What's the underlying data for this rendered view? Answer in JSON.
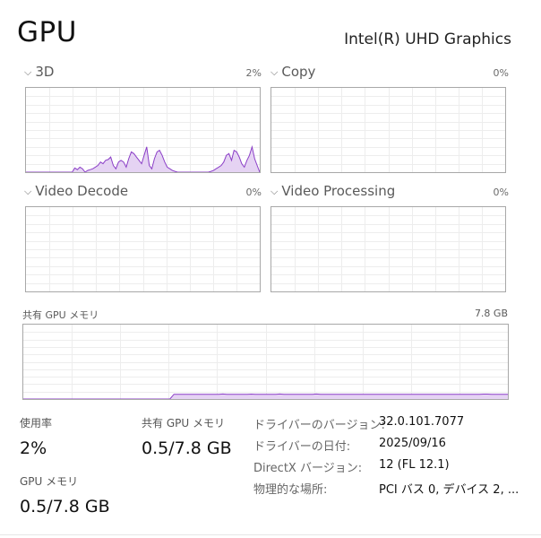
{
  "header": {
    "title": "GPU",
    "device_name": "Intel(R) UHD Graphics"
  },
  "graphs": [
    {
      "label": "3D",
      "percent": "2%",
      "values": [
        0,
        0,
        0,
        0,
        0,
        0,
        0,
        0,
        0,
        0,
        0,
        0,
        0,
        0,
        0,
        0,
        0,
        0,
        0,
        5,
        3,
        6,
        4,
        0,
        2,
        3,
        4,
        6,
        8,
        12,
        10,
        14,
        15,
        18,
        8,
        4,
        12,
        14,
        12,
        6,
        16,
        24,
        22,
        18,
        14,
        10,
        20,
        30,
        8,
        4,
        16,
        24,
        26,
        20,
        12,
        6,
        4,
        2,
        1,
        0,
        0,
        0,
        0,
        0,
        0,
        0,
        0,
        0,
        0,
        0,
        0,
        0,
        1,
        2,
        4,
        6,
        8,
        12,
        20,
        22,
        14,
        26,
        24,
        18,
        10,
        6,
        14,
        20,
        30,
        16,
        8,
        0
      ]
    },
    {
      "label": "Copy",
      "percent": "0%",
      "values": []
    },
    {
      "label": "Video Decode",
      "percent": "0%",
      "values": []
    },
    {
      "label": "Video Processing",
      "percent": "0%",
      "values": []
    }
  ],
  "shared_memory": {
    "label": "共有 GPU メモリ",
    "total": "7.8 GB",
    "values": [
      0,
      0,
      0,
      0,
      0,
      0,
      0,
      0,
      0,
      0,
      0,
      0,
      0,
      0,
      0,
      0,
      0,
      0,
      0,
      0,
      0,
      0,
      0,
      0,
      0,
      0,
      0,
      0,
      0,
      0,
      0,
      0,
      0,
      0,
      0,
      0,
      0,
      6.4,
      6.4,
      6.4,
      6.4,
      6.4,
      6.4,
      6.4,
      6.4,
      6.4,
      6.4,
      6.4,
      6.4,
      6.8,
      6.4,
      6.4,
      6.4,
      6.4,
      6.4,
      6.4,
      6.6,
      6.4,
      6.4,
      6.4,
      6.4,
      6.4,
      6.4,
      6.8,
      6.4,
      6.4,
      6.4,
      6.4,
      6.4,
      6.4,
      6.4,
      6.4,
      6.8,
      6.4,
      6.4,
      6.4,
      6.4,
      6.4,
      6.4,
      6.4,
      6.4,
      6.4,
      6.4,
      6.4,
      6.4,
      6.4,
      6.4,
      6.4,
      6.4,
      6.4,
      6.4,
      6.4,
      6.4,
      6.4,
      6.4,
      6.4,
      6.4,
      6.4,
      6.4,
      6.4,
      6.4,
      6.4,
      6.4,
      6.4,
      6.4,
      6.4,
      6.4,
      6.4,
      6.4,
      6.4,
      6.4,
      6.4,
      6.4,
      6.6,
      6.6,
      6.4,
      6.4,
      6.4,
      6.4,
      6.4
    ]
  },
  "stats": {
    "utilization": {
      "label": "使用率",
      "value": "2%"
    },
    "shared_gpu_memory": {
      "label": "共有 GPU メモリ",
      "value": "0.5/7.8 GB"
    },
    "gpu_memory": {
      "label": "GPU メモリ",
      "value": "0.5/7.8 GB"
    }
  },
  "details": [
    {
      "key": "ドライバーのバージョン:",
      "value": "32.0.101.7077"
    },
    {
      "key": "ドライバーの日付:",
      "value": "2025/09/16"
    },
    {
      "key": "DirectX バージョン:",
      "value": "12 (FL 12.1)"
    },
    {
      "key": "物理的な場所:",
      "value": "PCI バス 0, デバイス 2, ..."
    }
  ],
  "colors": {
    "accent": "#8b3fc7",
    "accent_fill": "#e5d3f3",
    "grid": "#ededed",
    "border": "#a8a8a8"
  }
}
